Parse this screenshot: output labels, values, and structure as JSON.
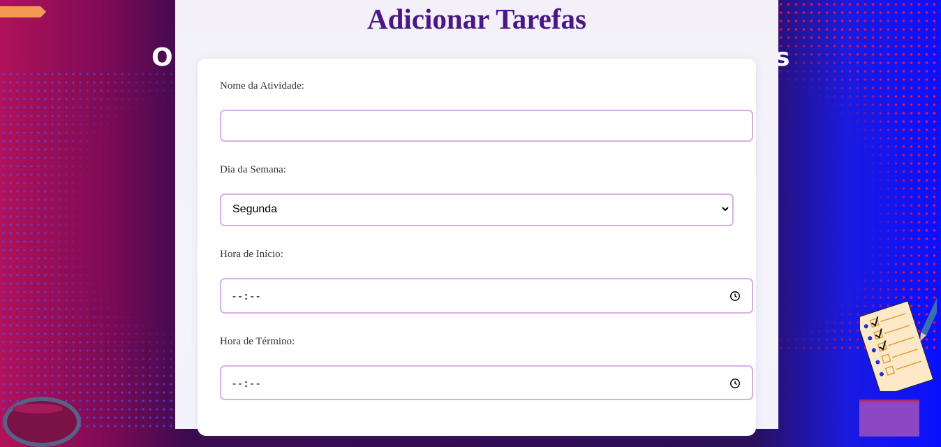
{
  "background": {
    "heading_left": "O",
    "heading_right": "s"
  },
  "page": {
    "title": "Adicionar Tarefas"
  },
  "form": {
    "activity_name": {
      "label": "Nome da Atividade:",
      "value": ""
    },
    "weekday": {
      "label": "Dia da Semana:",
      "selected": "Segunda"
    },
    "start_time": {
      "label": "Hora de Início:",
      "value": "--:--"
    },
    "end_time": {
      "label": "Hora de Término:",
      "value": "--:--"
    }
  },
  "icons": {
    "select_chevron": "chevron-down-icon",
    "time_picker": "clock-icon"
  },
  "colors": {
    "title": "#4a1785",
    "input_border": "#d9b0e6",
    "panel_bg": "#f4f3f9"
  }
}
